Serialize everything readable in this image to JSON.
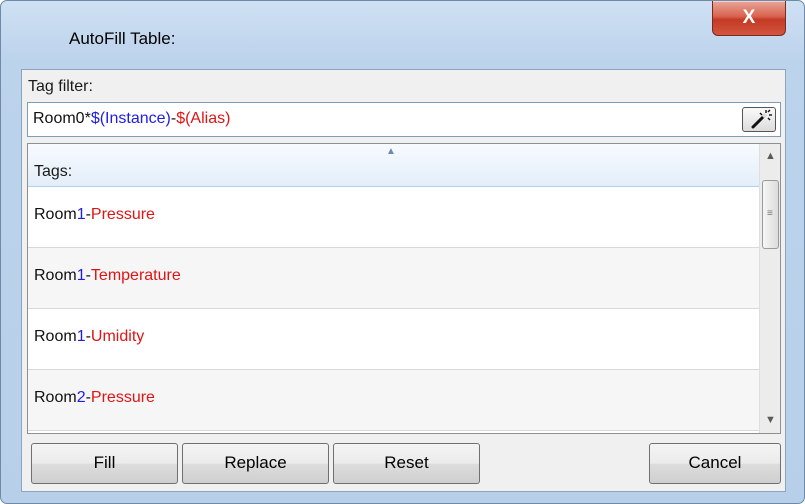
{
  "window": {
    "title": "AutoFill Table:",
    "close_label": "X"
  },
  "filter": {
    "label": "Tag filter:",
    "value_parts": {
      "prefix": "Room0*",
      "instance": "$(Instance)",
      "sep": "-",
      "alias": "$(Alias)"
    },
    "wand_icon": "magic-wand-icon"
  },
  "list": {
    "header": "Tags:",
    "rows": [
      {
        "prefix": "Room",
        "instance": "1",
        "sep": "-",
        "alias": "Pressure"
      },
      {
        "prefix": "Room",
        "instance": "1",
        "sep": "-",
        "alias": "Temperature"
      },
      {
        "prefix": "Room",
        "instance": "1",
        "sep": "-",
        "alias": "Umidity"
      },
      {
        "prefix": "Room",
        "instance": "2",
        "sep": "-",
        "alias": "Pressure"
      }
    ]
  },
  "buttons": {
    "fill": "Fill",
    "replace": "Replace",
    "reset": "Reset",
    "cancel": "Cancel"
  },
  "colors": {
    "instance": "#1e1ee6",
    "alias": "#e01414",
    "close": "#c43a25"
  }
}
